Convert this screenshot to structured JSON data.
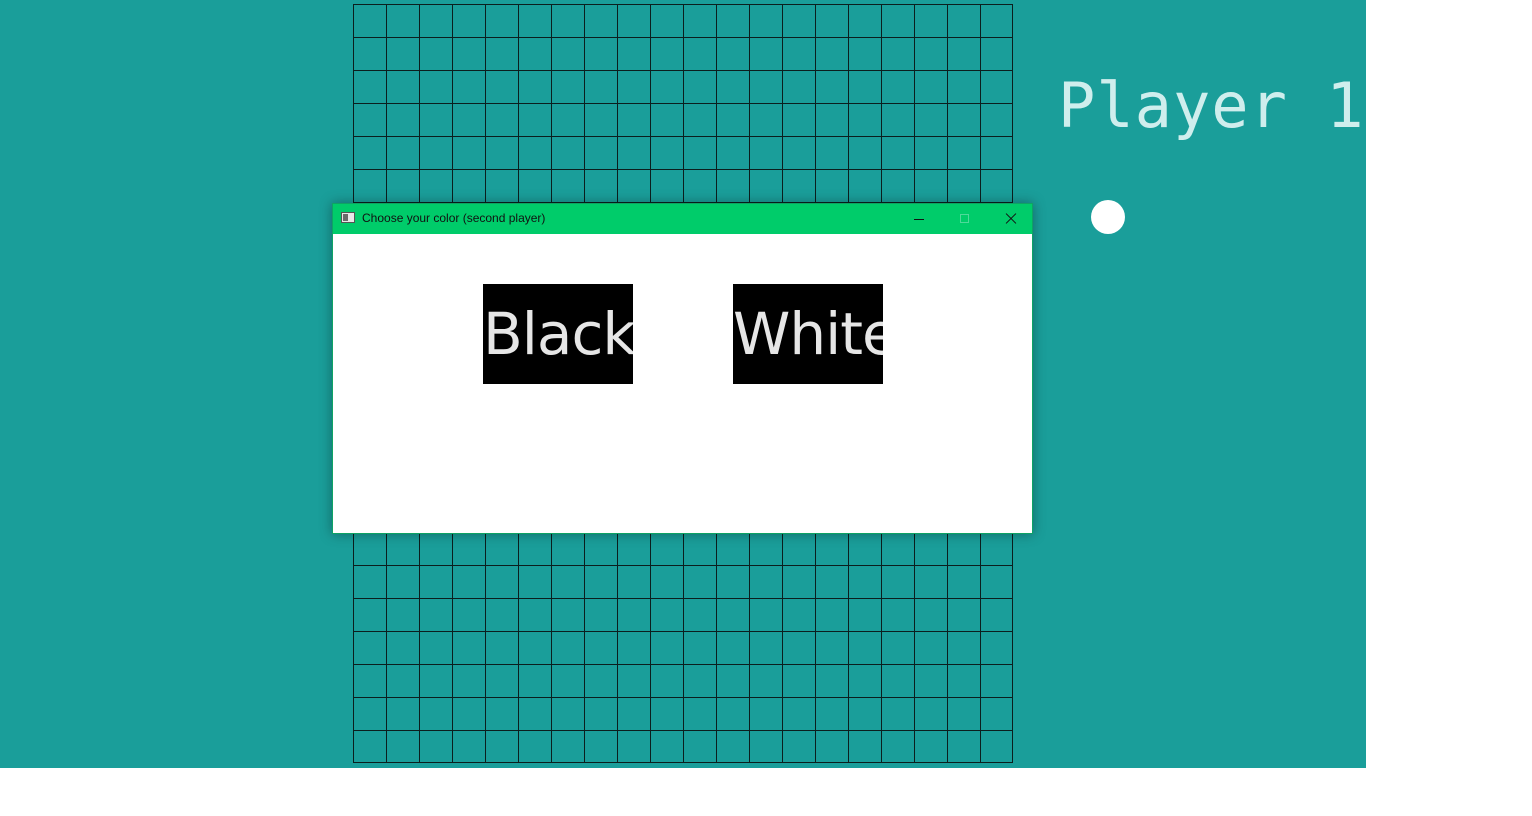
{
  "game": {
    "player_label": "Player 1",
    "board_cols": 20,
    "board_rows": 23,
    "current_piece_color": "#ffffff"
  },
  "dialog": {
    "title": "Choose your color (second player)",
    "controls": [
      "minimize-icon",
      "maximize-icon",
      "close-icon"
    ],
    "buttons": {
      "black_label": "Black",
      "white_label": "White"
    }
  },
  "colors": {
    "background": "#1a9e9a",
    "titlebar": "#00cc6a",
    "grid_lines": "#0b1f1e",
    "button_bg": "#000000"
  }
}
